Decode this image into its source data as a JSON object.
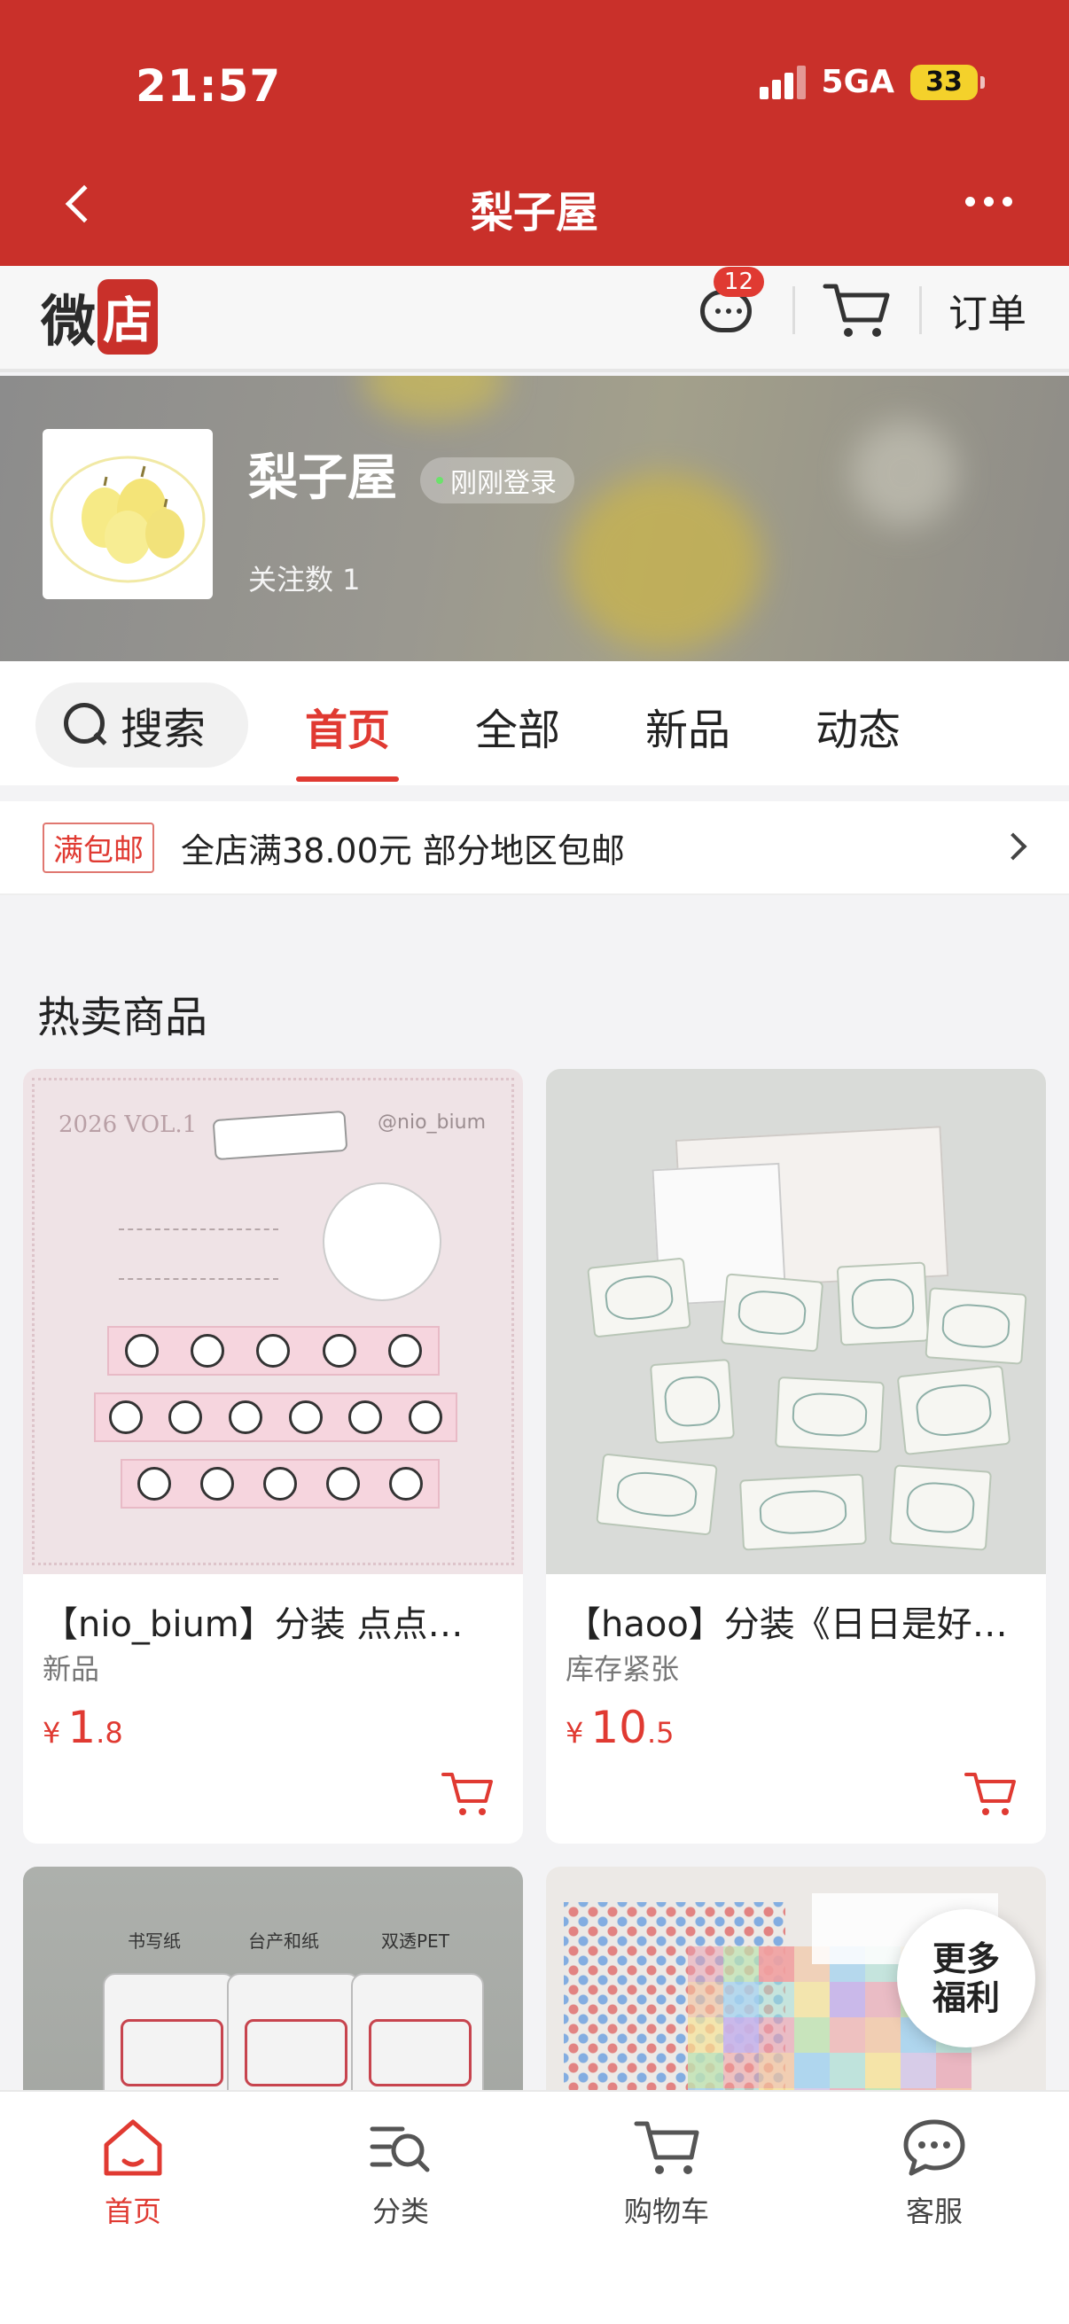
{
  "status": {
    "time": "21:57",
    "network": "5GA",
    "battery": "33"
  },
  "nav": {
    "title": "梨子屋"
  },
  "shop_header": {
    "logo_char1": "微",
    "logo_char2": "店",
    "message_count": "12",
    "orders_label": "订单"
  },
  "shop": {
    "name": "梨子屋",
    "login_status": "刚刚登录",
    "followers": "关注数 1"
  },
  "tabs": {
    "search_label": "搜索",
    "items": [
      "首页",
      "全部",
      "新品",
      "动态"
    ],
    "active_index": 0
  },
  "promo": {
    "tag": "满包邮",
    "text": "全店满38.00元 部分地区包邮"
  },
  "section_title": "热卖商品",
  "products": [
    {
      "title": "【nio_bium】分装 点点…",
      "subtitle": "新品",
      "currency": "¥",
      "price_int": "1",
      "price_dec": ".8"
    },
    {
      "title": "【haoo】分装《日日是好…",
      "subtitle": "库存紧张",
      "currency": "¥",
      "price_int": "10",
      "price_dec": ".5"
    }
  ],
  "product_images": {
    "img1": {
      "header": "2026 VOL.1",
      "handle": "@nio_bium"
    },
    "img3": {
      "captions": [
        "书写纸",
        "台产和纸",
        "双透PET"
      ]
    }
  },
  "fab": {
    "line1": "更多",
    "line2": "福利"
  },
  "bottom_nav": {
    "items": [
      "首页",
      "分类",
      "购物车",
      "客服"
    ],
    "active_index": 0
  },
  "colors": {
    "brand_red": "#c9302a",
    "accent_red": "#e03a32"
  }
}
